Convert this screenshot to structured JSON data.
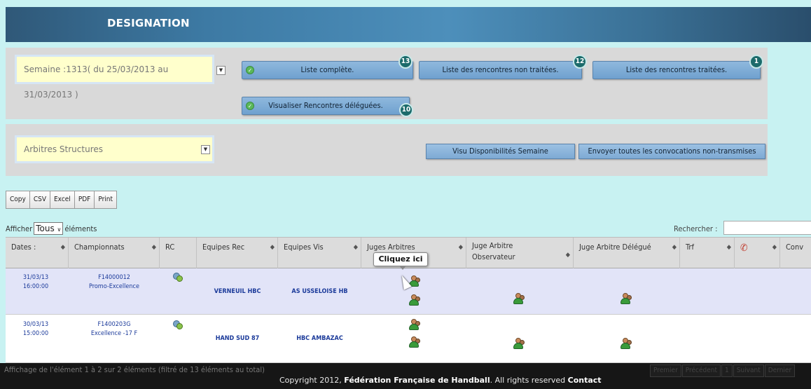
{
  "header": {
    "title": "DESIGNATION"
  },
  "filters": {
    "semaine": "Semaine :1313( du 25/03/2013 au 31/03/2013 )",
    "arbitres": "Arbitres Structures"
  },
  "buttons": {
    "liste_complete": {
      "label": "Liste complète.",
      "badge": "13"
    },
    "non_traitees": {
      "label": "Liste des rencontres non traitées.",
      "badge": "12"
    },
    "traitees": {
      "label": "Liste des rencontres traitées.",
      "badge": "1"
    },
    "deleguees": {
      "label": "Visualiser Rencontres déléguées.",
      "badge": "10"
    },
    "visu_dispo": "Visu Disponibilités Semaine",
    "envoyer": "Envoyer toutes les convocations non-transmises"
  },
  "toolbar": [
    "Copy",
    "CSV",
    "Excel",
    "PDF",
    "Print"
  ],
  "length": {
    "prefix": "Afficher",
    "value": "Tous",
    "suffix": "éléments"
  },
  "search": {
    "label": "Rechercher :"
  },
  "table": {
    "columns": [
      "Dates :",
      "Championnats",
      "RC",
      "Equipes Rec",
      "Equipes Vis",
      "Juges Arbitres",
      "Juge Arbitre Observateur",
      "Juge Arbitre Délégué",
      "Trf",
      "",
      "Conv"
    ],
    "rows": [
      {
        "date": "31/03/13",
        "time": "16:00:00",
        "champ_code": "F14000012",
        "champ_name": "Promo-Excellence",
        "rec": "VERNEUIL HBC",
        "vis": "AS USSELOISE HB"
      },
      {
        "date": "30/03/13",
        "time": "15:00:00",
        "champ_code": "F1400203G",
        "champ_name": "Excellence -17 F",
        "rec": "HAND SUD 87",
        "vis": "HBC AMBAZAC"
      }
    ]
  },
  "tooltip": "Cliquez ici",
  "footer": {
    "info": "Affichage de l'élément 1 à 2 sur 2 éléments (filtré de 13 éléments au total)",
    "copy_prefix": "Copyright 2012,",
    "org": "Fédération Française de Handball",
    "rights": ". All rights reserved",
    "contact": "Contact",
    "pager": [
      "Premier",
      "Précédent",
      "1",
      "Suivant",
      "Dernier"
    ]
  },
  "colors": {
    "header": "#3d7aa4",
    "panel": "#d9d9d9",
    "background": "#c8f2f2",
    "badge": "#1c6b6b",
    "row_highlight": "#e2e4f8"
  }
}
